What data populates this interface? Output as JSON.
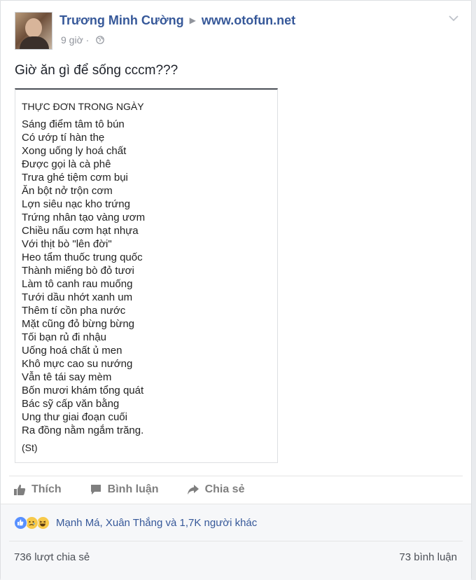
{
  "post": {
    "author": "Trương Minh Cường",
    "target": "www.otofun.net",
    "time": "9 giờ",
    "text": "Giờ ăn gì để sống cccm???"
  },
  "image": {
    "title": "THỰC ĐƠN TRONG NGÀY",
    "lines": [
      "Sáng điểm tâm tô bún",
      "Có ướp tí hàn thẹ",
      "Xong uống ly hoá chất",
      "Được gọi là cà phê",
      "Trưa ghé tiệm cơm bụi",
      "Ăn bột nở trộn cơm",
      "Lợn siêu nạc kho trứng",
      "Trứng nhân tạo vàng ươm",
      "Chiều nấu cơm hạt nhựa",
      "Với thịt bò \"lên đời\"",
      "Heo tẩm thuốc trung quốc",
      "Thành miếng bò đỏ tươi",
      "Làm tô canh rau muống",
      "Tưới dầu nhớt xanh um",
      "Thêm tí cồn pha nước",
      "Mặt cũng đỏ bừng bừng",
      "Tối bạn rủ đi nhậu",
      "Uống hoá chất ủ men",
      "Khô mực cao su nướng",
      "Vẫn tê tái say mèm",
      "Bốn mươi khám tổng quát",
      "Bác sỹ cấp văn bằng",
      "Ung thư giai đoạn cuối",
      "Ra đồng nằm ngắm trăng."
    ],
    "credit": "(St)"
  },
  "actions": {
    "like": "Thích",
    "comment": "Bình luận",
    "share": "Chia sẻ"
  },
  "reactions": {
    "icons": [
      "like-icon",
      "sad-icon",
      "haha-icon"
    ],
    "names": "Mạnh Má, Xuân Thắng và 1,7K người khác"
  },
  "stats": {
    "shares": "736 lượt chia sẻ",
    "comments": "73 bình luận"
  },
  "colors": {
    "link": "#365899",
    "muted": "#90949c",
    "action": "#7f7f7f",
    "like": "#5890ff",
    "emoji": "#f7c94a"
  }
}
